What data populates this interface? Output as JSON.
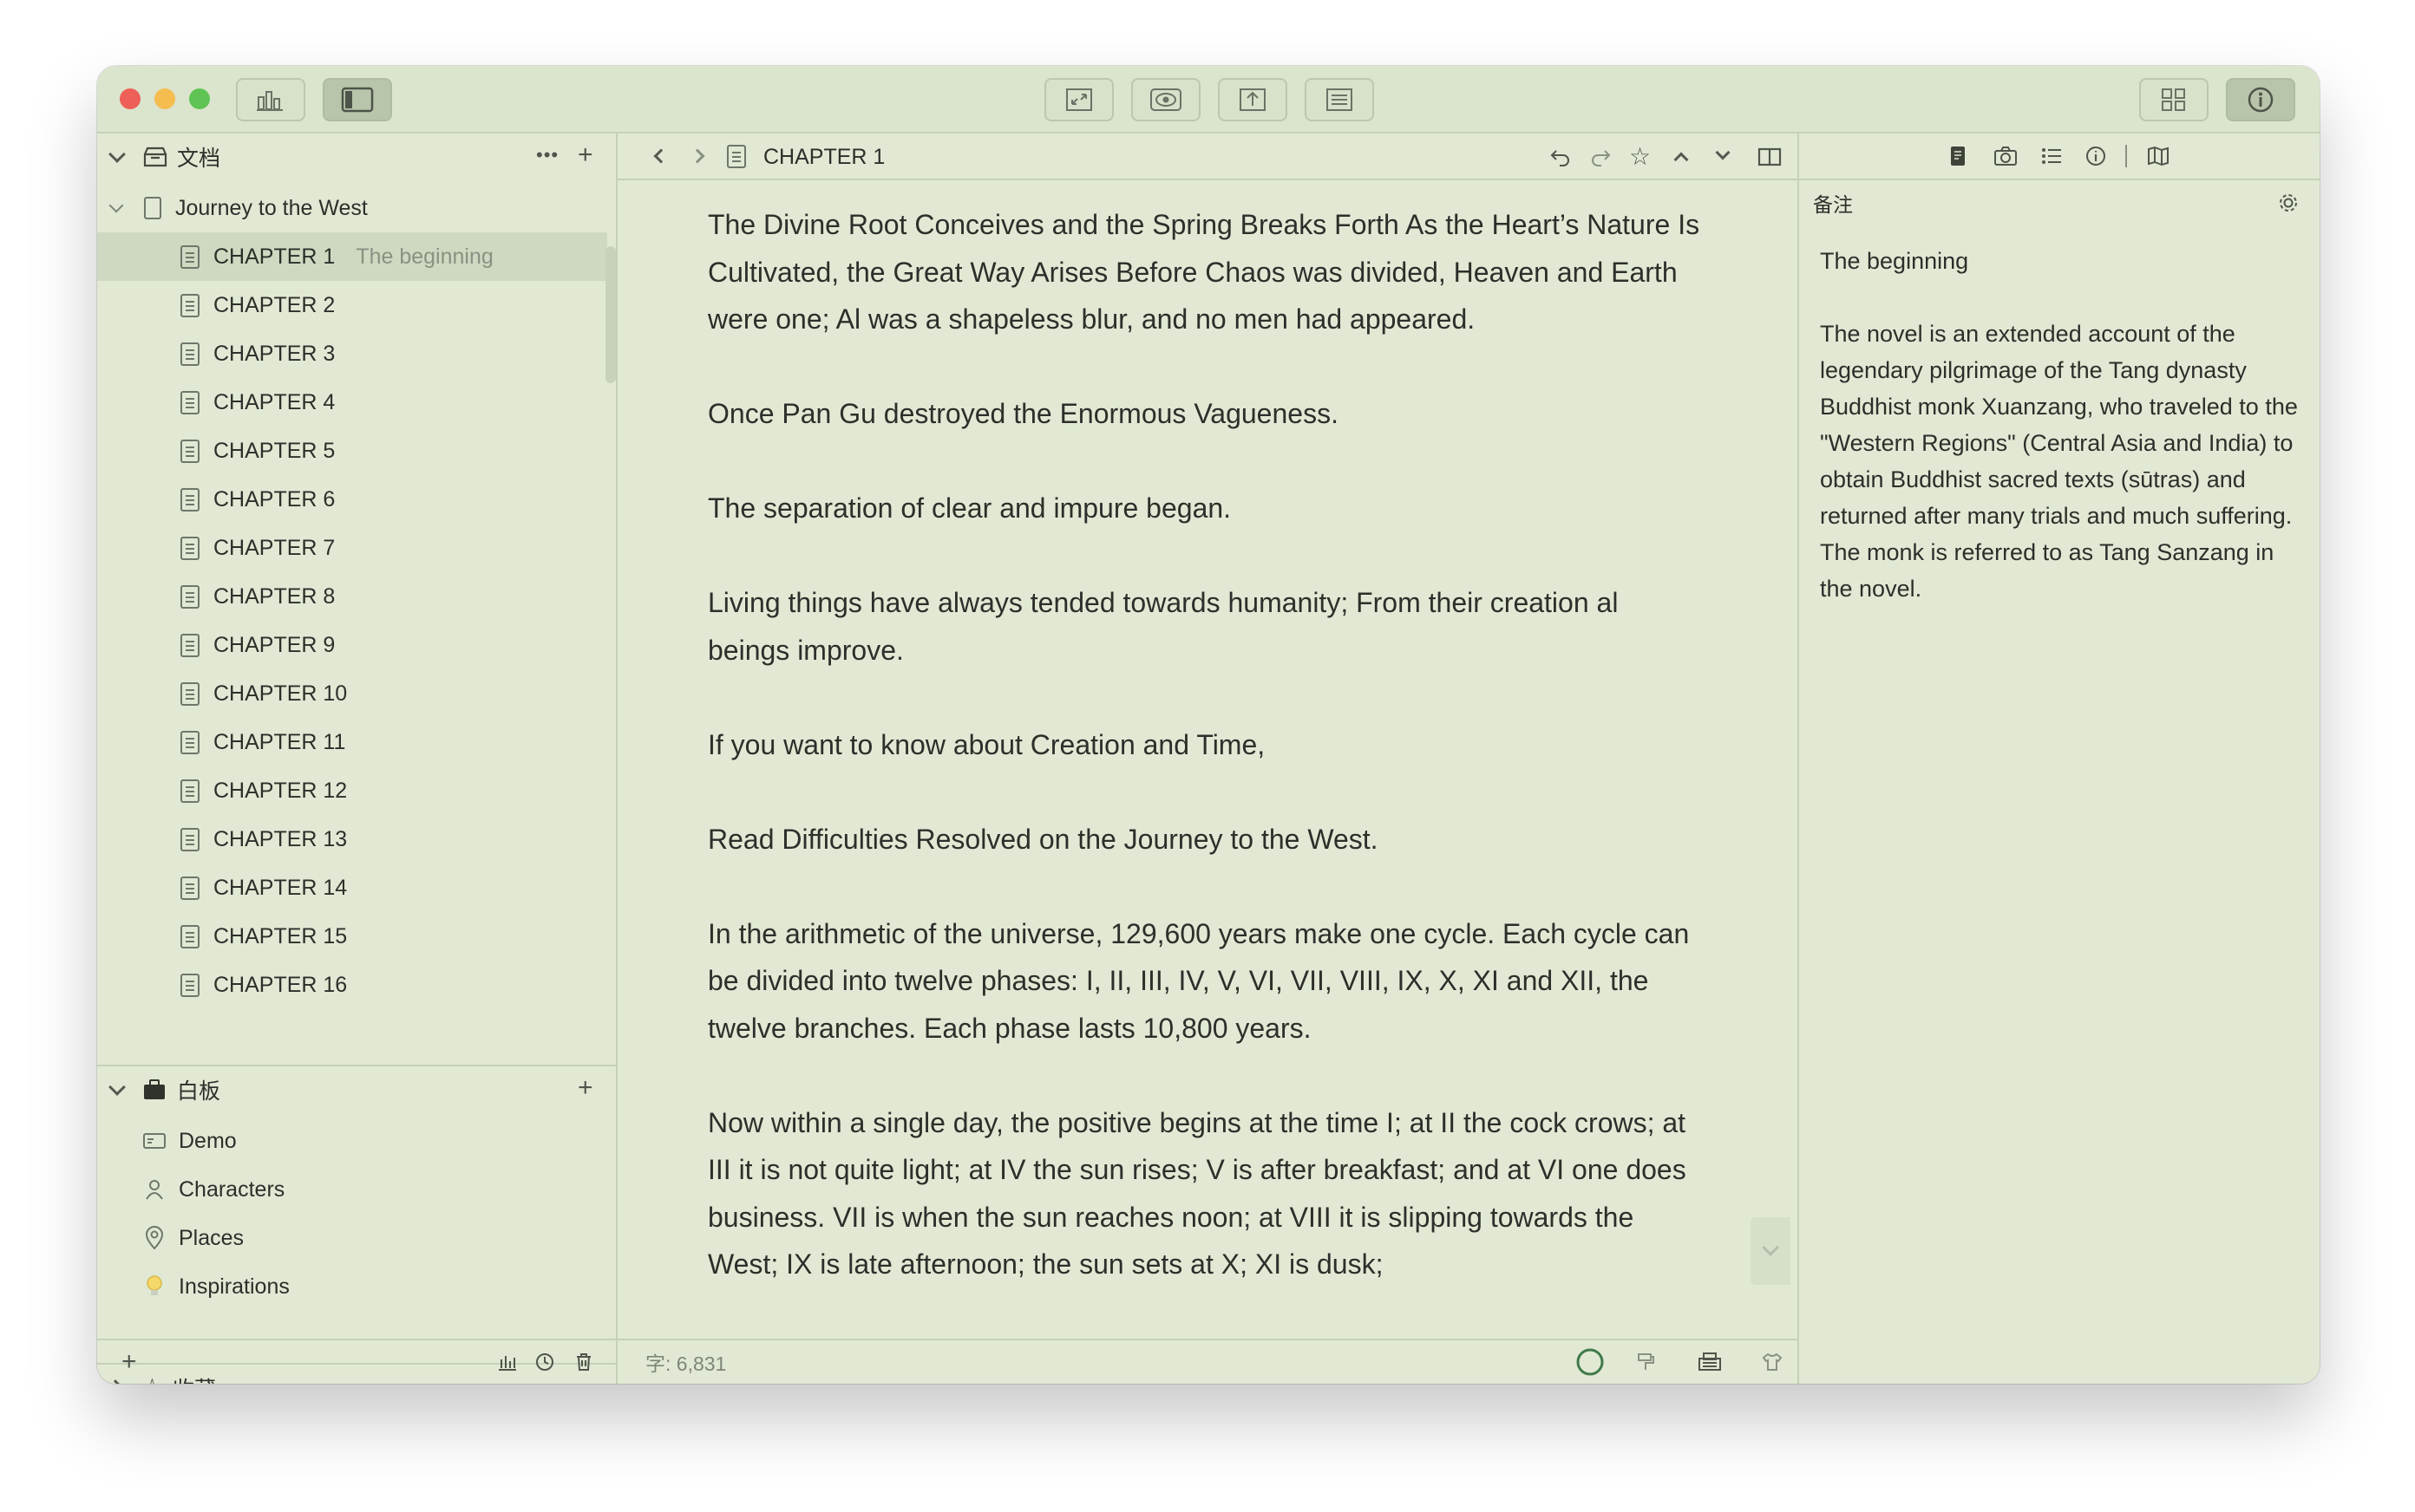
{
  "toolbar": {
    "left_buttons": [
      "stats-icon",
      "sidebar-toggle-icon"
    ],
    "center_buttons": [
      "fullscreen-icon",
      "preview-eye-icon",
      "export-icon",
      "outline-icon"
    ],
    "right_buttons": [
      "grid-view-icon",
      "info-icon"
    ]
  },
  "sidebar": {
    "documents_header": "文档",
    "project_title": "Journey to the West",
    "chapters": [
      {
        "label": "CHAPTER 1",
        "sub": "The beginning",
        "selected": true
      },
      {
        "label": "CHAPTER 2"
      },
      {
        "label": "CHAPTER 3"
      },
      {
        "label": "CHAPTER 4"
      },
      {
        "label": "CHAPTER 5"
      },
      {
        "label": "CHAPTER 6"
      },
      {
        "label": "CHAPTER 7"
      },
      {
        "label": "CHAPTER 8"
      },
      {
        "label": "CHAPTER 9"
      },
      {
        "label": "CHAPTER 10"
      },
      {
        "label": "CHAPTER 11"
      },
      {
        "label": "CHAPTER 12"
      },
      {
        "label": "CHAPTER 13"
      },
      {
        "label": "CHAPTER 14"
      },
      {
        "label": "CHAPTER 15"
      },
      {
        "label": "CHAPTER 16"
      }
    ],
    "whiteboard_header": "白板",
    "whiteboard_items": [
      {
        "label": "Demo",
        "icon": "card-icon"
      },
      {
        "label": "Characters",
        "icon": "person-icon"
      },
      {
        "label": "Places",
        "icon": "location-pin-icon"
      },
      {
        "label": "Inspirations",
        "icon": "lightbulb-icon"
      }
    ],
    "favorites_header": "收藏"
  },
  "editor": {
    "title": "CHAPTER 1",
    "word_count": "字: 6,831",
    "paragraphs": [
      "The Divine Root Conceives and the Spring Breaks Forth As the Heart’s Nature Is Cultivated, the Great Way Arises Before Chaos was divided, Heaven and Earth were one; Al was a shapeless blur, and no men had appeared.",
      "Once Pan Gu destroyed the Enormous Vagueness.",
      "The separation of clear and impure began.",
      "Living things have always tended towards humanity; From their creation al beings improve.",
      "If you want to know about Creation and Time,",
      "Read Difficulties Resolved on the Journey to the West.",
      "In the arithmetic of the universe, 129,600 years make one cycle. Each cycle can be divided into twelve phases: I, II, III, IV, V, VI, VII, VIII, IX, X, XI and XII, the twelve branches. Each phase lasts 10,800 years.",
      "Now within a single day, the positive begins at the time I; at II the cock crows; at III it is not quite light; at IV the sun rises; V is after breakfast; and at VI one does business. VII is when the sun reaches noon; at VIII it is slipping towards the West; IX is late afternoon; the sun sets at X; XI is dusk;"
    ]
  },
  "inspector": {
    "notes_label": "备注",
    "note_title": "The beginning",
    "note_body": "The novel is an extended account of the legendary pilgrimage of the Tang dynasty Buddhist monk Xuanzang, who traveled to the \"Western Regions\" (Central Asia and India) to obtain Buddhist sacred texts (sūtras) and returned after many trials and much suffering. The monk is referred to as Tang Sanzang in the novel."
  },
  "colors": {
    "window_bg": "#e1e9d4",
    "selection": "#cfd9c1",
    "traffic_red": "#ee5f57",
    "traffic_yellow": "#f5bd4f",
    "traffic_green": "#5fc454"
  }
}
